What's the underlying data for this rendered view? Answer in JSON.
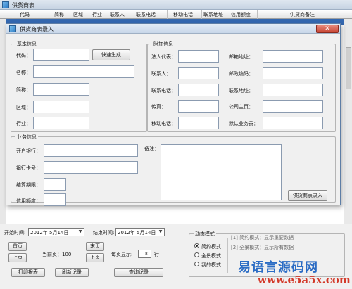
{
  "main": {
    "title": "供货商表",
    "columns": [
      "代码",
      "简称",
      "区域",
      "行业",
      "联系人",
      "联系电话",
      "移动电话",
      "联系地址",
      "信用额度",
      "供货商备注"
    ]
  },
  "dialog": {
    "title": "供货商表录入",
    "close_label": "✕",
    "basic": {
      "title": "基本信息",
      "code_label": "代码：",
      "gen_button": "快速生成",
      "name_label": "名称：",
      "short_label": "简称：",
      "region_label": "区域：",
      "industry_label": "行业："
    },
    "extra": {
      "title": "附加信息",
      "legal_label": "法人代表：",
      "contact_label": "联系人：",
      "phone_label": "联系电话：",
      "fax_label": "传真：",
      "mobile_label": "移动电话：",
      "postal_addr_label": "邮箱地址：",
      "zip_label": "邮政编码：",
      "address_label": "联系地址：",
      "homepage_label": "公司主页：",
      "salesman_label": "默认业务员："
    },
    "business": {
      "title": "业务信息",
      "bank_label": "开户银行：",
      "card_label": "银行卡号：",
      "settle_label": "结算期限：",
      "credit_label": "信用额度：",
      "remark_label": "备注：",
      "submit_button": "供货商表录入"
    }
  },
  "bottom": {
    "start_label": "开始时间:",
    "start_value": "2012年 5月14日",
    "end_label": "结束时间:",
    "end_value": "2012年 5月14日",
    "first_page": "首页",
    "last_page": "末页",
    "prev_page": "上页",
    "next_page": "下页",
    "current_page_label": "当前页：100",
    "per_page_label": "每页显示:",
    "per_page_value": "100",
    "per_page_unit": "行",
    "print_button": "打印报表",
    "refresh_button": "刷新记录",
    "query_button": "查询记录",
    "mode": {
      "title": "动态模式",
      "options": [
        "简约模式",
        "全景模式",
        "我的模式"
      ],
      "selected": "简约模式",
      "hints": [
        "[1] 简约模式：显示重要数据",
        "[2] 全景模式：显示所有数据"
      ]
    }
  },
  "watermark": {
    "line1": "易语言源码网",
    "line2": "www.e5a5x.com"
  },
  "colors": {
    "accent": "#2b6cc4",
    "close": "#c74332",
    "watermark_red": "#d33a2a"
  }
}
